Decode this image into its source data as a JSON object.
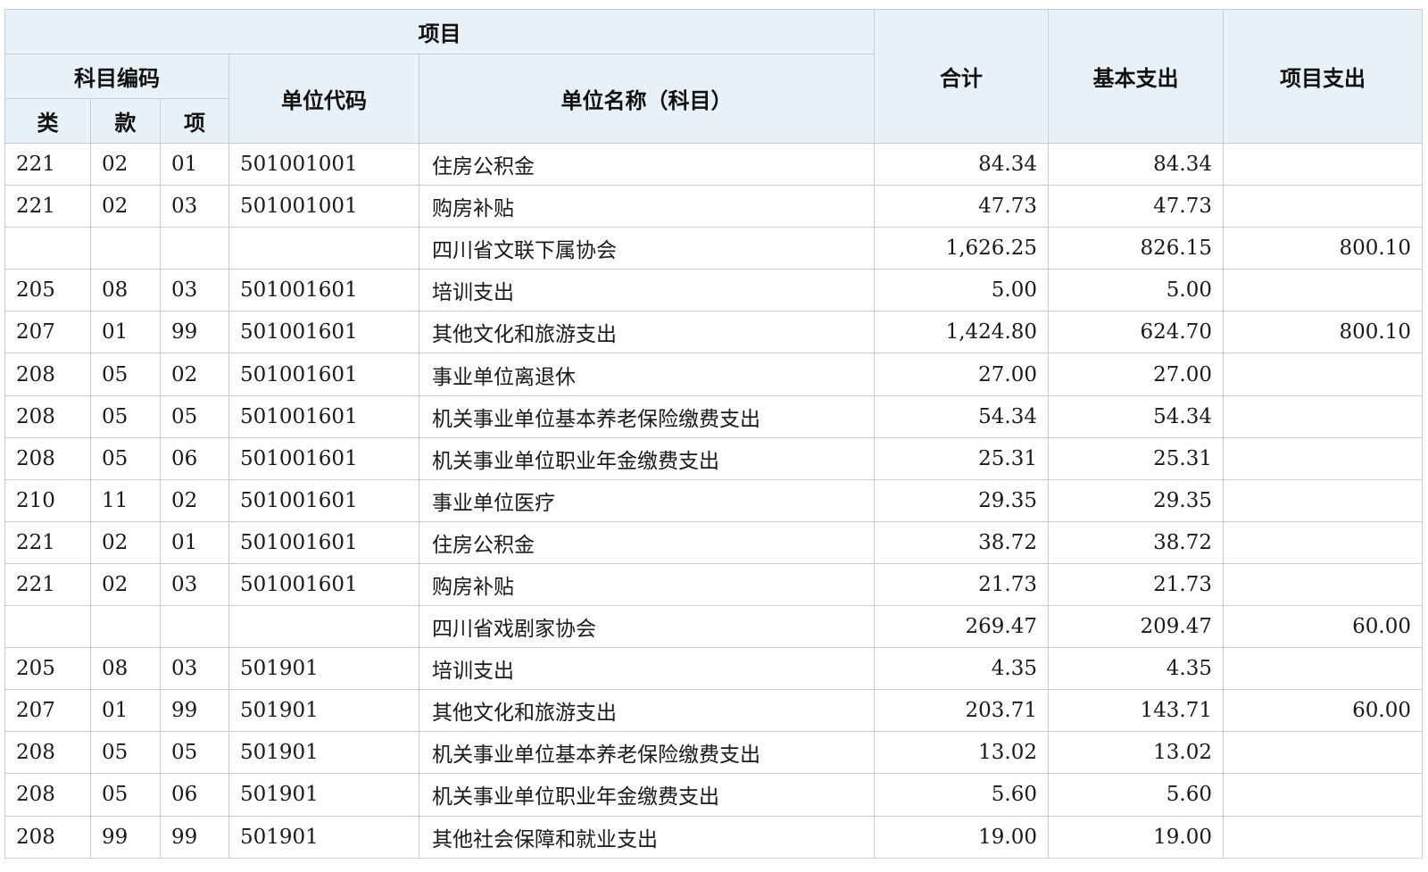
{
  "headers": {
    "xiangmu": "项目",
    "kemu_bianma": "科目编码",
    "lei": "类",
    "kuan": "款",
    "xiang": "项",
    "danwei_daima": "单位代码",
    "danwei_mingcheng": "单位名称（科目）",
    "heji": "合计",
    "jiben_zhichu": "基本支出",
    "xiangmu_zhichu": "项目支出"
  },
  "rows": [
    {
      "lei": "221",
      "kuan": "02",
      "xiang": "01",
      "code": "501001001",
      "name": "住房公积金",
      "total": "84.34",
      "basic": "84.34",
      "project": ""
    },
    {
      "lei": "221",
      "kuan": "02",
      "xiang": "03",
      "code": "501001001",
      "name": "购房补贴",
      "total": "47.73",
      "basic": "47.73",
      "project": ""
    },
    {
      "lei": "",
      "kuan": "",
      "xiang": "",
      "code": "",
      "name": "四川省文联下属协会",
      "total": "1,626.25",
      "basic": "826.15",
      "project": "800.10"
    },
    {
      "lei": "205",
      "kuan": "08",
      "xiang": "03",
      "code": "501001601",
      "name": "培训支出",
      "total": "5.00",
      "basic": "5.00",
      "project": ""
    },
    {
      "lei": "207",
      "kuan": "01",
      "xiang": "99",
      "code": "501001601",
      "name": "其他文化和旅游支出",
      "total": "1,424.80",
      "basic": "624.70",
      "project": "800.10"
    },
    {
      "lei": "208",
      "kuan": "05",
      "xiang": "02",
      "code": "501001601",
      "name": "事业单位离退休",
      "total": "27.00",
      "basic": "27.00",
      "project": ""
    },
    {
      "lei": "208",
      "kuan": "05",
      "xiang": "05",
      "code": "501001601",
      "name": "机关事业单位基本养老保险缴费支出",
      "total": "54.34",
      "basic": "54.34",
      "project": ""
    },
    {
      "lei": "208",
      "kuan": "05",
      "xiang": "06",
      "code": "501001601",
      "name": "机关事业单位职业年金缴费支出",
      "total": "25.31",
      "basic": "25.31",
      "project": ""
    },
    {
      "lei": "210",
      "kuan": "11",
      "xiang": "02",
      "code": "501001601",
      "name": "事业单位医疗",
      "total": "29.35",
      "basic": "29.35",
      "project": ""
    },
    {
      "lei": "221",
      "kuan": "02",
      "xiang": "01",
      "code": "501001601",
      "name": "住房公积金",
      "total": "38.72",
      "basic": "38.72",
      "project": ""
    },
    {
      "lei": "221",
      "kuan": "02",
      "xiang": "03",
      "code": "501001601",
      "name": "购房补贴",
      "total": "21.73",
      "basic": "21.73",
      "project": ""
    },
    {
      "lei": "",
      "kuan": "",
      "xiang": "",
      "code": "",
      "name": "四川省戏剧家协会",
      "total": "269.47",
      "basic": "209.47",
      "project": "60.00"
    },
    {
      "lei": "205",
      "kuan": "08",
      "xiang": "03",
      "code": "501901",
      "name": "培训支出",
      "total": "4.35",
      "basic": "4.35",
      "project": ""
    },
    {
      "lei": "207",
      "kuan": "01",
      "xiang": "99",
      "code": "501901",
      "name": "其他文化和旅游支出",
      "total": "203.71",
      "basic": "143.71",
      "project": "60.00"
    },
    {
      "lei": "208",
      "kuan": "05",
      "xiang": "05",
      "code": "501901",
      "name": "机关事业单位基本养老保险缴费支出",
      "total": "13.02",
      "basic": "13.02",
      "project": ""
    },
    {
      "lei": "208",
      "kuan": "05",
      "xiang": "06",
      "code": "501901",
      "name": "机关事业单位职业年金缴费支出",
      "total": "5.60",
      "basic": "5.60",
      "project": ""
    },
    {
      "lei": "208",
      "kuan": "99",
      "xiang": "99",
      "code": "501901",
      "name": "其他社会保障和就业支出",
      "total": "19.00",
      "basic": "19.00",
      "project": ""
    }
  ]
}
